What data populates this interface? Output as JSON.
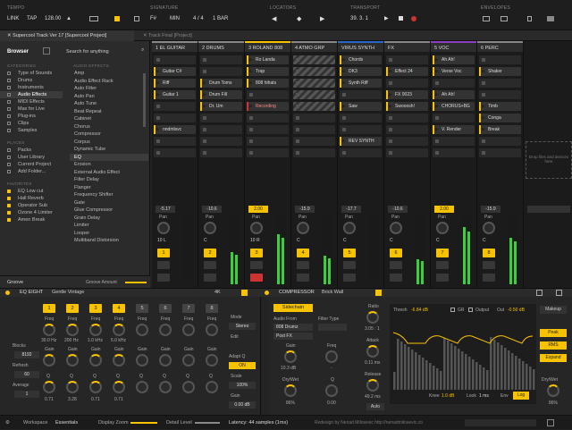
{
  "transport": {
    "tempo_label": "TEMPO",
    "link": "LINK",
    "tap": "TAP",
    "bpm": "128.00",
    "signature_label": "SIGNATURE",
    "key": "F#",
    "scale": "MIN",
    "meter": "4 / 4",
    "quant": "1 BAR",
    "locators_label": "LOCATORS",
    "transport_label": "TRANSPORT",
    "position": "39. 3. 1",
    "envelopes_label": "ENVELOPES"
  },
  "tabs": {
    "active": "Supercool Track Ver 17 [Supercool Project]",
    "inactive": "Track Final [Project]"
  },
  "browser": {
    "title": "Browser",
    "search_placeholder": "Search for anything",
    "categories_label": "CATEGORIES",
    "categories": [
      "Type of Sounds",
      "Drums",
      "Instruments",
      "Audio Effects",
      "MIDI Effects",
      "Max for Live",
      "Plug-ins",
      "Clips",
      "Samples"
    ],
    "selected_category": 3,
    "places_label": "PLACES",
    "places": [
      "Packs",
      "User Library",
      "Current Project",
      "Add Folder..."
    ],
    "favorites_label": "FAVORITES",
    "favorites": [
      "EQ Low cut",
      "Hall Reverb",
      "Operator Sub",
      "Ozone 4 Limiter",
      "Amen Break"
    ],
    "content_label": "AUDIO EFFECTS",
    "content": [
      "Amp",
      "Audio Effect Rack",
      "Auto Filter",
      "Auto Pan",
      "Auto Tune",
      "Beat Repeat",
      "Cabinet",
      "Chorus",
      "Compressor",
      "Corpus",
      "Dynamic Tube",
      "EQ",
      "Erosion",
      "External Audio Effect",
      "Filter Delay",
      "Flanger",
      "Frequency Shifter",
      "Gate",
      "Glue Compressor",
      "Grain Delay",
      "Limiter",
      "Looper",
      "Multiband Distorsion"
    ],
    "selected_content": 11,
    "groove": "Groove",
    "groove_amount": "Groove Amount"
  },
  "tracks": [
    {
      "name": "1 EL GUITAR",
      "color": "#888888",
      "clips": [
        {
          "row": 1,
          "label": "Guitar C#",
          "color": "#f7c200"
        },
        {
          "row": 2,
          "label": "Riff",
          "color": "#f7c200"
        },
        {
          "row": 3,
          "label": "Guitar 1",
          "color": "#f7c200"
        },
        {
          "row": 6,
          "label": "nndmlsvc",
          "color": "#f7c200"
        }
      ],
      "vol": "-5.17",
      "pan": "10 L",
      "num": "1",
      "meter": 0.0
    },
    {
      "name": "2 DRUMS",
      "color": "#888888",
      "clips": [
        {
          "row": 2,
          "label": "Drum Toms",
          "color": "#f7c200"
        },
        {
          "row": 3,
          "label": "Drum Fill",
          "color": "#f7c200"
        },
        {
          "row": 4,
          "label": "Dr. Um",
          "color": "#f7c200"
        }
      ],
      "vol": "-10.6",
      "pan": "C",
      "num": "2",
      "meter": 0.45
    },
    {
      "name": "3 ROLAND 808",
      "color": "#f7c200",
      "clips": [
        {
          "row": 0,
          "label": "Ro Landa",
          "color": "#f7c200"
        },
        {
          "row": 1,
          "label": "Trap",
          "color": "#f7c200"
        },
        {
          "row": 2,
          "label": "808 hihats",
          "color": "#f7c200"
        },
        {
          "row": 4,
          "label": "Recording",
          "color": "#cc3333"
        }
      ],
      "vol": "2.00",
      "pan": "10 R",
      "num": "3",
      "meter": 0.7
    },
    {
      "name": "4 ATMO GRP",
      "color": "#888888",
      "clips": [],
      "vol": "-15.9",
      "pan": "C",
      "num": "4",
      "meter": 0.4
    },
    {
      "name": "VIRUS SYNTH",
      "color": "#2b66c9",
      "clips": [
        {
          "row": 0,
          "label": "Chords",
          "color": "#f7c200"
        },
        {
          "row": 1,
          "label": "DK3",
          "color": "#f7c200"
        },
        {
          "row": 2,
          "label": "Synth Riff",
          "color": "#f7c200"
        },
        {
          "row": 4,
          "label": "Saw",
          "color": "#f7c200"
        },
        {
          "row": 7,
          "label": "REV SYNTH",
          "color": "#f7c200"
        }
      ],
      "vol": "-17.7",
      "pan": "C",
      "num": "5",
      "meter": 0.0
    },
    {
      "name": "FX",
      "color": "#888888",
      "clips": [
        {
          "row": 1,
          "label": "Effect 24",
          "color": "#f7c200"
        },
        {
          "row": 3,
          "label": "FX 0023",
          "color": "#f7c200"
        },
        {
          "row": 4,
          "label": "Swooosh!",
          "color": "#f7c200"
        }
      ],
      "vol": "-10.6",
      "pan": "C",
      "num": "6",
      "meter": 0.35
    },
    {
      "name": "5 VOC",
      "color": "#8a3fbf",
      "clips": [
        {
          "row": 0,
          "label": "Ah Ah!",
          "color": "#f7c200"
        },
        {
          "row": 1,
          "label": "Verse Voc",
          "color": "#f7c200"
        },
        {
          "row": 3,
          "label": "Ah Ah!",
          "color": "#f7c200"
        },
        {
          "row": 4,
          "label": "CHORUS+BG",
          "color": "#f7c200"
        },
        {
          "row": 6,
          "label": "V. Render",
          "color": "#f7c200"
        }
      ],
      "vol": "2.00",
      "pan": "C",
      "num": "7",
      "meter": 0.8
    },
    {
      "name": "6 PERC",
      "color": "#888888",
      "clips": [
        {
          "row": 1,
          "label": "Shaker",
          "color": "#f7c200"
        },
        {
          "row": 4,
          "label": "Timb",
          "color": "#f7c200"
        },
        {
          "row": 5,
          "label": "Conga",
          "color": "#f7c200"
        },
        {
          "row": 6,
          "label": "Break",
          "color": "#f7c200"
        }
      ],
      "vol": "-15.9",
      "pan": "C",
      "num": "8",
      "meter": 0.65
    }
  ],
  "drop_hint": "Drop files and devices here",
  "eq": {
    "name": "EQ EIGHT",
    "preset": "Gentle Vintage",
    "mode_label": "Mode",
    "mode": "Stereo",
    "edit_label": "Edit",
    "adapt_label": "Adapt Q",
    "adapt": "ON",
    "scale_label": "Scale",
    "scale": "100%",
    "gain_label": "Gain",
    "gain": "0.00 dB",
    "blocks_label": "Blocks",
    "blocks": "8192",
    "refresh_label": "Refresh",
    "refresh": "60",
    "average_label": "Average",
    "average": "1",
    "freq_label": "Freq",
    "gain_lbl": "Gain",
    "q_label": "Q",
    "bands": [
      {
        "n": "1",
        "freq": "30.0 Hz",
        "gain": "0.71"
      },
      {
        "n": "2",
        "freq": "200 Hz",
        "gain": "3.28"
      },
      {
        "n": "3",
        "freq": "1.0 kHz",
        "gain": "0.71"
      },
      {
        "n": "4",
        "freq": "5.0 kHz",
        "gain": "0.71"
      },
      {
        "n": "5",
        "freq": "",
        "gain": ""
      },
      {
        "n": "6",
        "freq": "",
        "gain": ""
      },
      {
        "n": "7",
        "freq": "",
        "gain": ""
      },
      {
        "n": "8",
        "freq": "",
        "gain": ""
      }
    ],
    "four_k": "4K"
  },
  "compressor": {
    "name": "COMPRESSOR",
    "preset": "Brick Wall",
    "sidechain": "Sidechain",
    "audio_from_label": "Audio From",
    "audio_from": "808 Drumz",
    "post_fx": "Post FX",
    "filter_type_label": "Filter Type",
    "gain_label": "Gain",
    "gain_val": "10.3 dB",
    "drywet_label": "Dry/Wet",
    "drywet_val": "86%",
    "freq_label": "Freq",
    "freq_val": "-",
    "q_label": "Q",
    "q_val": "0.00",
    "ratio_label": "Ratio",
    "ratio": "3.05 : 1",
    "attack_label": "Attack",
    "attack": "0.11 ms",
    "release_label": "Release",
    "release": "49.2 ms",
    "auto": "Auto",
    "thresh_label": "Thresh",
    "thresh": "-6.84 dB",
    "gr": "GR",
    "output": "Output",
    "out_label": "Out",
    "out_val": "-0.50 dB",
    "knee_label": "Knee",
    "knee": "1.0 dB",
    "look_label": "Look",
    "look": "1 ms",
    "env_label": "Env",
    "log": "Log",
    "peak": "Peak",
    "rms": "RMS",
    "expand": "Expand",
    "makeup": "Makeup",
    "drywet2_label": "Dry/Wet",
    "drywet2": "86%"
  },
  "status": {
    "workspace_label": "Workspace",
    "workspace": "Essentials",
    "zoom": "Display Zoom",
    "detail": "Detail Level",
    "latency": "Latency: 44 samples (1ms)",
    "credit": "Redesign by Nenad Milosevic http://nenadmilosevic.co"
  },
  "colors": {
    "accent": "#f7c200",
    "record": "#cc3333",
    "meter": "#3ad13a"
  }
}
